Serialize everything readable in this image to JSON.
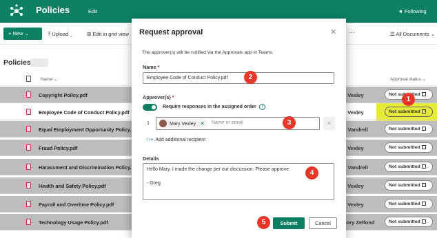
{
  "site": {
    "title": "Policies",
    "edit_label": "Edit",
    "follow_label": "Following",
    "brand_color": "#0d8063"
  },
  "toolbar": {
    "new_label": "+ New ⌄",
    "upload_label": "⤒ Upload ⌄",
    "grid_label": "⊞ Edit in grid view",
    "more_label": "···",
    "view_label": "☰ All Documents ⌄"
  },
  "list": {
    "title": "Policies",
    "col_name": "Name ⌄",
    "col_status": "Approval status ⌄",
    "rows": [
      {
        "name": "Copyright Policy.pdf",
        "person": "y Vexley",
        "status": "Not submitted"
      },
      {
        "name": "Employee Code of Conduct Policy.pdf",
        "person": "y Vexley",
        "status": "Not submitted"
      },
      {
        "name": "Equal Employment Opportunity Policy.",
        "person": "n Vandrell",
        "status": "Not submitted"
      },
      {
        "name": "Fraud Policy.pdf",
        "person": "y Vexley",
        "status": "Not submitted"
      },
      {
        "name": "Harassment and Discrimination Policy.",
        "person": "n Vandrell",
        "status": "Not submitted"
      },
      {
        "name": "Health and Safety Policy.pdf",
        "person": "y Vexley",
        "status": "Not submitted"
      },
      {
        "name": "Payroll and Overtime Policy.pdf",
        "person": "y Vexley",
        "status": "Not submitted"
      },
      {
        "name": "Technology Usage Policy.pdf",
        "person": "gory Zelfond",
        "status": "Not submitted"
      }
    ]
  },
  "dialog": {
    "title": "Request approval",
    "intro": "The approver(s) will be notified via the Approvals app in Teams.",
    "name_label": "Name",
    "name_value": "Employee Code of Conduct Policy.pdf",
    "approvers_label": "Approver(s)",
    "toggle_label": "Require responses in the assigned order",
    "approver_index": "1",
    "approver_chip": "Mary Vexley",
    "approver_placeholder": "Name or email",
    "add_recipient": "Add additional recipient",
    "details_label": "Details",
    "details_value": "Hello Mary. I made the change per our discussion. Please approve.\n\n- Greg",
    "submit_label": "Submit",
    "cancel_label": "Cancel",
    "required_mark": "*"
  },
  "callouts": [
    "1",
    "2",
    "3",
    "4",
    "5"
  ]
}
